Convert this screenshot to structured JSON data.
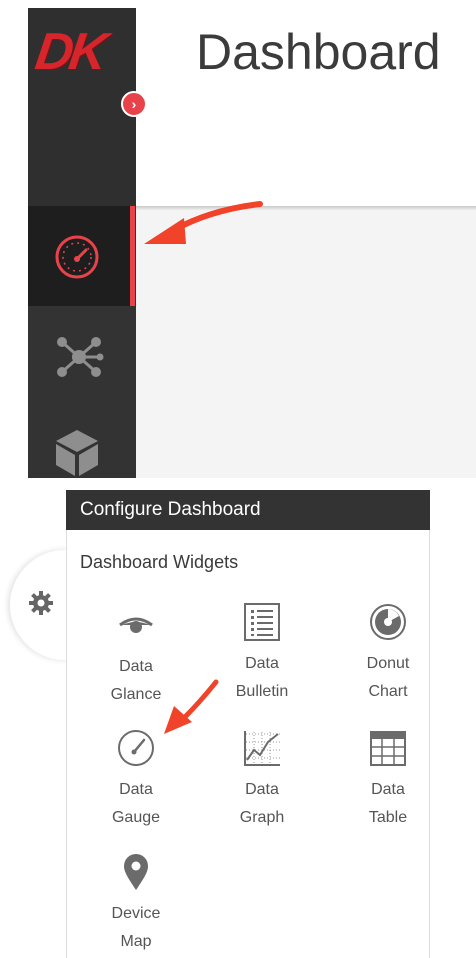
{
  "top": {
    "logo_text": "DK",
    "page_title": "Dashboard",
    "nav": [
      {
        "name": "Dashboard",
        "icon": "speedometer-icon",
        "active": true
      },
      {
        "name": "Network",
        "icon": "network-nodes-icon",
        "active": false
      },
      {
        "name": "Devices",
        "icon": "cube-icon",
        "active": false
      }
    ],
    "expand_glyph": "›"
  },
  "bottom": {
    "panel_title": "Configure Dashboard",
    "section_title": "Dashboard Widgets",
    "widgets": [
      {
        "line1": "Data",
        "line2": "Glance",
        "icon": "eye-icon"
      },
      {
        "line1": "Data",
        "line2": "Bulletin",
        "icon": "bulletin-list-icon"
      },
      {
        "line1": "Donut",
        "line2": "Chart",
        "icon": "donut-chart-icon"
      },
      {
        "line1": "Data",
        "line2": "Gauge",
        "icon": "gauge-icon"
      },
      {
        "line1": "Data",
        "line2": "Graph",
        "icon": "line-graph-icon"
      },
      {
        "line1": "Data",
        "line2": "Table",
        "icon": "table-grid-icon"
      },
      {
        "line1": "Device",
        "line2": "Map",
        "icon": "map-pin-icon"
      }
    ]
  },
  "colors": {
    "accent_red": "#e8434a",
    "sidebar_bg": "#333334",
    "header_dark": "#333333",
    "icon_gray": "#6b6b6b"
  }
}
